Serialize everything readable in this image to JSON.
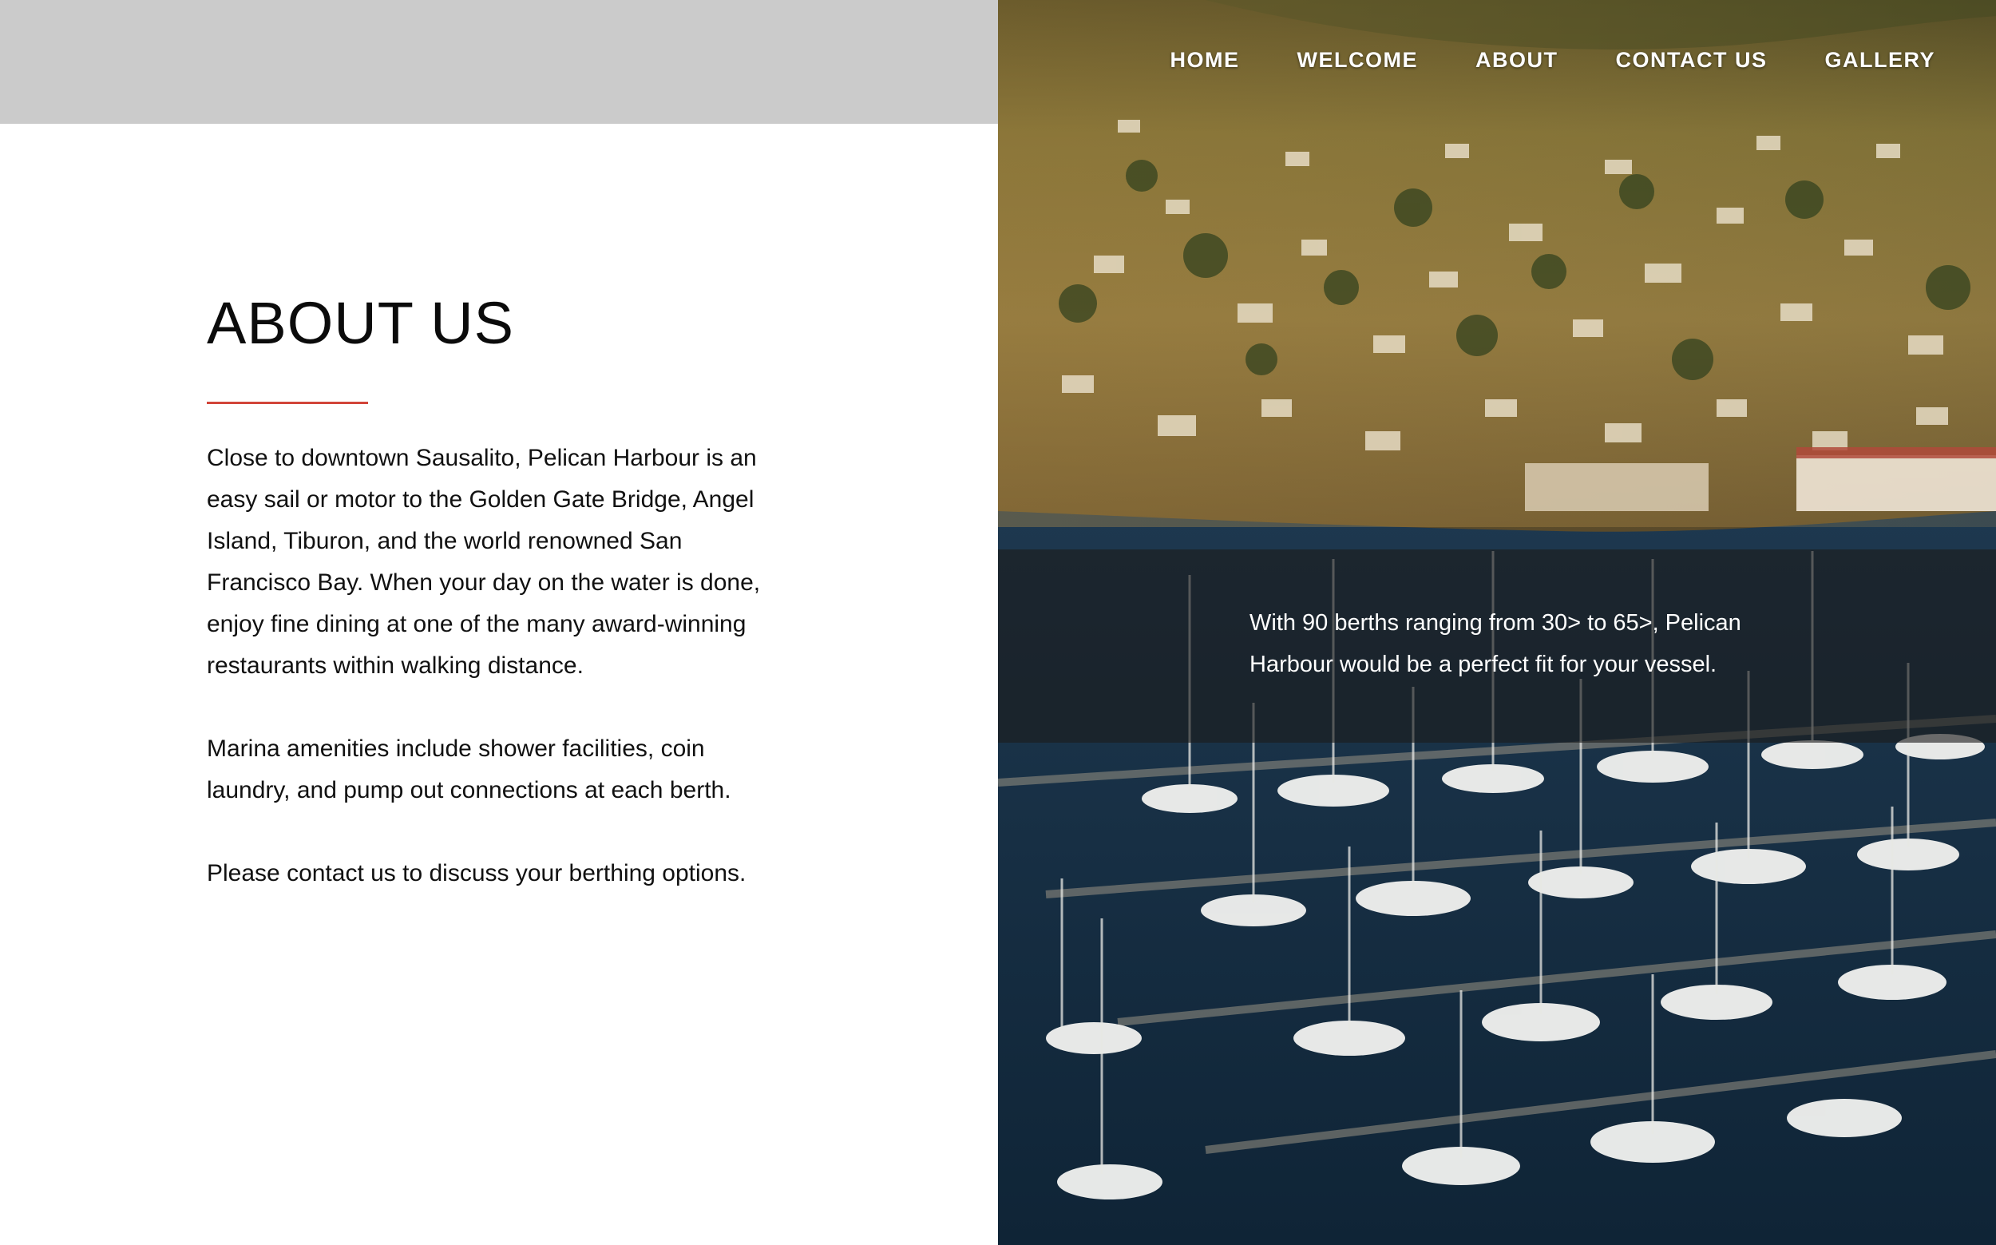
{
  "nav": {
    "items": [
      {
        "label": "HOME"
      },
      {
        "label": "WELCOME"
      },
      {
        "label": "ABOUT"
      },
      {
        "label": "CONTACT US"
      },
      {
        "label": "GALLERY"
      }
    ]
  },
  "about": {
    "title": "ABOUT US",
    "accent_color": "#d2453a",
    "paragraphs": [
      "Close to downtown Sausalito, Pelican Harbour is an easy sail or motor to the Golden Gate Bridge, Angel Island, Tiburon, and the world renowned San Francisco Bay.  When your day on the water is done, enjoy fine dining at one of the many award-winning restaurants within walking distance.",
      "Marina amenities include shower facilities, coin laundry, and pump out connections at each berth.",
      "Please contact us to discuss your berthing options."
    ]
  },
  "hero": {
    "image": "marina-hillside-photo",
    "caption": "With 90 berths ranging from 30> to 65>, Pelican Harbour would be a perfect fit for your vessel."
  },
  "colors": {
    "top_bar": "#cbcbcb",
    "caption_band": "rgba(28,28,28,0.62)",
    "water": "#1d3a52",
    "hillside": "#5c5a2c"
  }
}
